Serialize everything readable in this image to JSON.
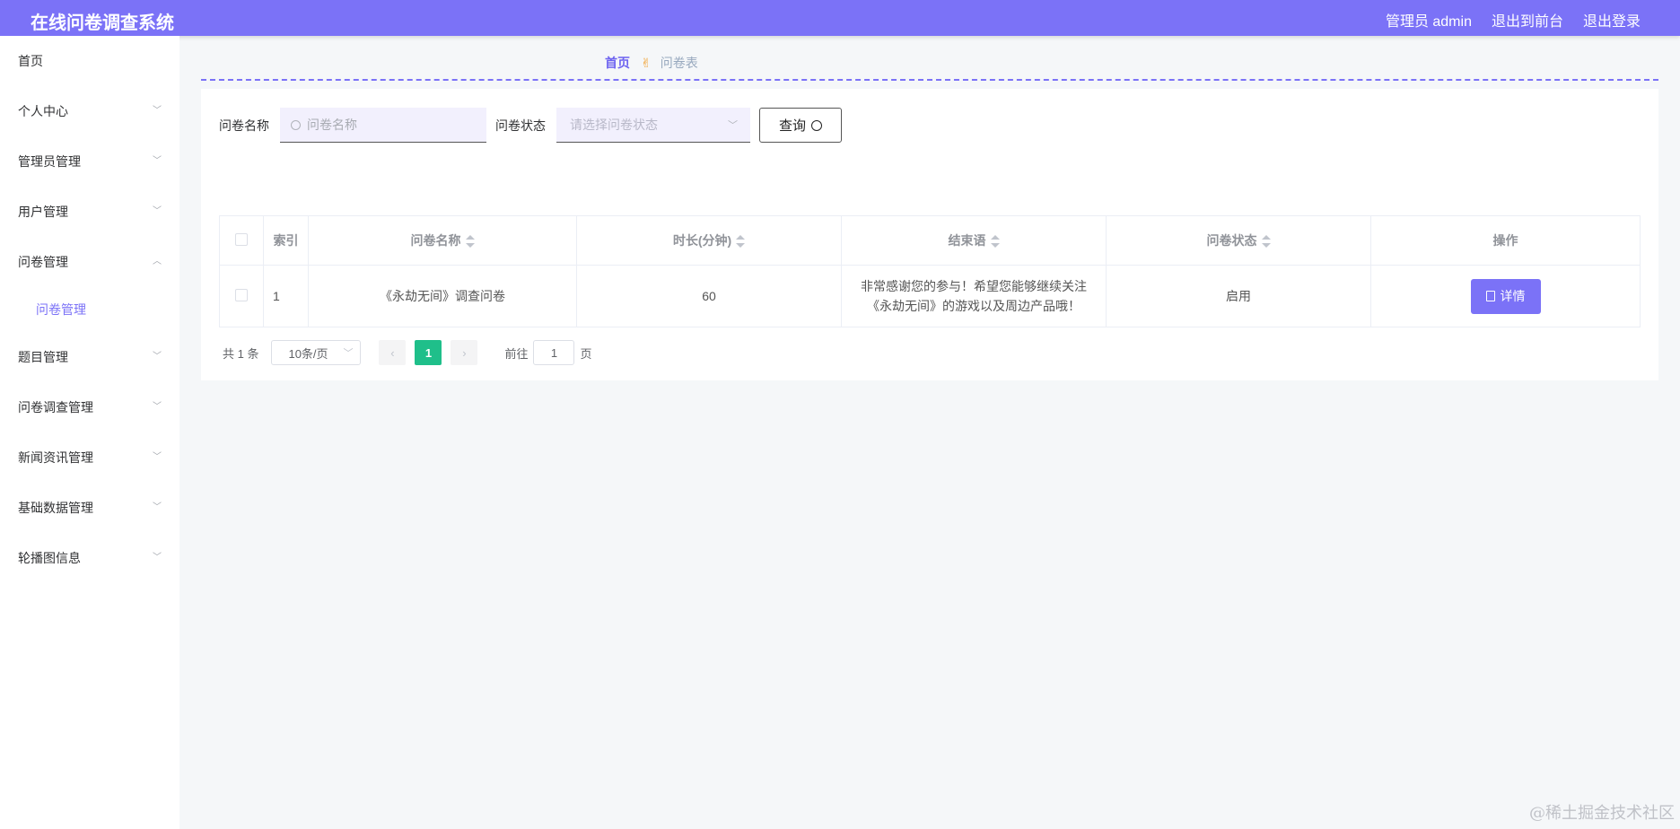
{
  "header": {
    "title": "在线问卷调查系统",
    "nav": [
      "管理员 admin",
      "退出到前台",
      "退出登录"
    ]
  },
  "sidebar": {
    "items": [
      {
        "label": "首页",
        "chevron": ""
      },
      {
        "label": "个人中心",
        "chevron": "﹀"
      },
      {
        "label": "管理员管理",
        "chevron": "﹀"
      },
      {
        "label": "用户管理",
        "chevron": "﹀"
      },
      {
        "label": "问卷管理",
        "chevron": "︿"
      },
      {
        "label": "问卷管理",
        "chevron": ""
      },
      {
        "label": "题目管理",
        "chevron": "﹀"
      },
      {
        "label": "问卷调查管理",
        "chevron": "﹀"
      },
      {
        "label": "新闻资讯管理",
        "chevron": "﹀"
      },
      {
        "label": "基础数据管理",
        "chevron": "﹀"
      },
      {
        "label": "轮播图信息",
        "chevron": "﹀"
      }
    ]
  },
  "breadcrumb": {
    "home": "首页",
    "separator": "✌",
    "current": "问卷表"
  },
  "search": {
    "name_label": "问卷名称",
    "name_placeholder": "问卷名称",
    "status_label": "问卷状态",
    "status_placeholder": "请选择问卷状态",
    "query_label": "查询"
  },
  "table": {
    "headers": {
      "index": "索引",
      "name": "问卷名称",
      "duration": "时长(分钟)",
      "closing": "结束语",
      "status": "问卷状态",
      "actions": "操作"
    },
    "rows": [
      {
        "index": "1",
        "name": "《永劫无间》调查问卷",
        "duration": "60",
        "closing": "非常感谢您的参与！希望您能够继续关注《永劫无间》的游戏以及周边产品哦！",
        "status": "启用",
        "action": "详情"
      }
    ]
  },
  "pagination": {
    "total": "共 1 条",
    "page_size": "10条/页",
    "prev": "‹",
    "current_page": "1",
    "next": "›",
    "goto_label": "前往",
    "goto_value": "1",
    "goto_suffix": "页"
  },
  "watermark": "@稀土掘金技术社区",
  "colors": {
    "accent": "#7b72f7",
    "page_active": "#1fbf8a"
  }
}
